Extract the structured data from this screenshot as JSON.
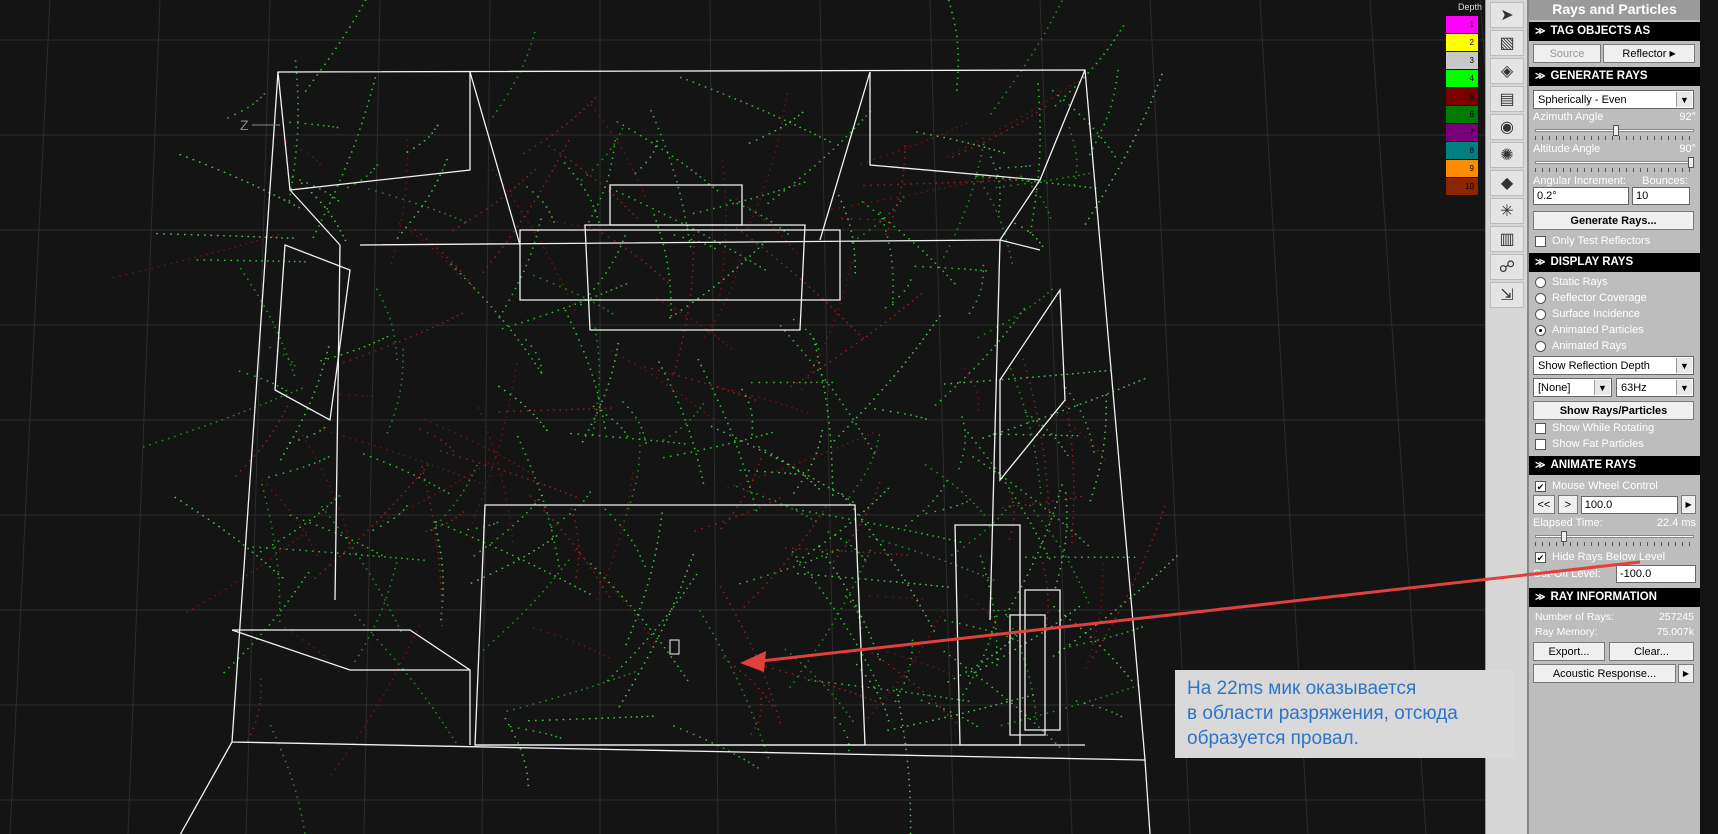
{
  "panel": {
    "title": "Rays and Particles",
    "tag_objects": {
      "header": "TAG OBJECTS AS",
      "source_label": "Source",
      "reflector_label": "Reflector"
    },
    "generate": {
      "header": "GENERATE RAYS",
      "mode": "Spherically - Even",
      "azimuth_label": "Azimuth Angle",
      "azimuth_value": "92°",
      "azimuth_level": 0.51,
      "altitude_label": "Altitude Angle",
      "altitude_value": "90°",
      "altitude_level": 1.0,
      "increment_label": "Angular Increment:",
      "bounces_label": "Bounces:",
      "increment_value": "0.2°",
      "bounces_value": "10",
      "generate_button": "Generate Rays...",
      "only_test_label": "Only Test Reflectors"
    },
    "display": {
      "header": "DISPLAY RAYS",
      "options": [
        "Static Rays",
        "Reflector Coverage",
        "Surface Incidence",
        "Animated Particles",
        "Animated Rays"
      ],
      "selected_index": 3,
      "show_mode": "Show Reflection Depth",
      "filter": "[None]",
      "frequency": "63Hz",
      "show_button": "Show Rays/Particles",
      "show_while_rotating": "Show While Rotating",
      "show_fat": "Show Fat Particles"
    },
    "animate": {
      "header": "ANIMATE RAYS",
      "mouse_wheel": "Mouse Wheel Control",
      "rewind": "<<",
      "step": ">",
      "speed": "100.0",
      "elapsed_label": "Elapsed Time:",
      "elapsed_value": "22.4 ms",
      "elapsed_level": 0.17,
      "hide_below": "Hide Rays Below Level",
      "cutoff_label": "Cut-Off Level:",
      "cutoff_value": "-100.0"
    },
    "info": {
      "header": "RAY INFORMATION",
      "rays_label": "Number of Rays:",
      "rays_value": "257245",
      "memory_label": "Ray Memory:",
      "memory_value": "75.007k",
      "export_button": "Export...",
      "clear_button": "Clear...",
      "acoustic_button": "Acoustic Response..."
    }
  },
  "depth_legend": {
    "title": "Depth",
    "items": [
      {
        "label": "1",
        "color": "#ff00ff"
      },
      {
        "label": "2",
        "color": "#ffff00"
      },
      {
        "label": "3",
        "color": "#c8c8c8"
      },
      {
        "label": "4",
        "color": "#00ff00"
      },
      {
        "label": "5",
        "color": "#7a0000"
      },
      {
        "label": "6",
        "color": "#007a00"
      },
      {
        "label": "7",
        "color": "#7a007a"
      },
      {
        "label": "8",
        "color": "#008080"
      },
      {
        "label": "9",
        "color": "#ff8c00"
      },
      {
        "label": "10",
        "color": "#8b2500"
      }
    ]
  },
  "toolbar": {
    "tools": [
      "pointer-icon",
      "materials-icon",
      "objects-icon",
      "layers-icon",
      "view-icon",
      "sun-icon",
      "surfaces-icon",
      "rays-icon",
      "trash-icon",
      "tree-icon",
      "export-icon"
    ]
  },
  "callout": {
    "lines": [
      "На 22ms мик оказывается",
      "в области разряжения, отсюда",
      "образуется провал."
    ]
  },
  "axis_label": "Z"
}
